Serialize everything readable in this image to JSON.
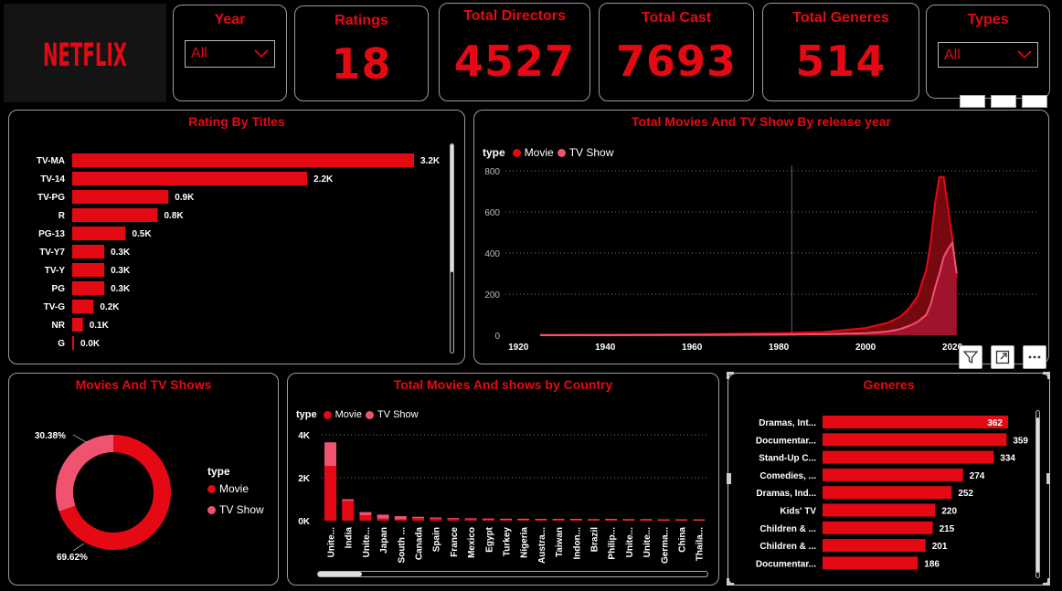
{
  "logo": "NETFLIX",
  "year_slicer": {
    "title": "Year",
    "value": "All"
  },
  "type_slicer": {
    "title": "Types",
    "value": "All"
  },
  "kpis": [
    {
      "title": "Ratings",
      "value": "18"
    },
    {
      "title": "Total Directors",
      "value": "4527"
    },
    {
      "title": "Total Cast",
      "value": "7693"
    },
    {
      "title": "Total Generes",
      "value": "514"
    }
  ],
  "colors": {
    "movie": "#e50914",
    "tv_show": "#ef5370",
    "accent": "#e50914",
    "background": "#000000"
  },
  "rating": {
    "title": "Rating By Titles",
    "chart_data": {
      "type": "bar",
      "orientation": "horizontal",
      "categories": [
        "TV-MA",
        "TV-14",
        "TV-PG",
        "R",
        "PG-13",
        "TV-Y7",
        "TV-Y",
        "PG",
        "TV-G",
        "NR",
        "G"
      ],
      "values": [
        3200,
        2200,
        900,
        800,
        500,
        300,
        300,
        300,
        200,
        100,
        0
      ],
      "labels": [
        "3.2K",
        "2.2K",
        "0.9K",
        "0.8K",
        "0.5K",
        "0.3K",
        "0.3K",
        "0.3K",
        "0.2K",
        "0.1K",
        "0.0K"
      ]
    }
  },
  "release": {
    "title": "Total Movies And TV Show By release year",
    "legend_title": "type",
    "chart_data": {
      "type": "area",
      "x_ticks": [
        "1920",
        "1940",
        "1960",
        "1980",
        "2000",
        "2020"
      ],
      "y_ticks": [
        "800",
        "600",
        "400",
        "200",
        "0"
      ],
      "xlim": [
        1917,
        2040
      ],
      "ylim": [
        0,
        800
      ],
      "grid": true,
      "series": [
        {
          "name": "Movie",
          "x": [
            1925,
            1940,
            1960,
            1980,
            1990,
            2000,
            2005,
            2008,
            2010,
            2012,
            2014,
            2015,
            2016,
            2017,
            2018,
            2019,
            2020,
            2021
          ],
          "values": [
            2,
            3,
            5,
            10,
            15,
            35,
            60,
            90,
            130,
            190,
            320,
            450,
            640,
            770,
            770,
            620,
            470,
            280
          ]
        },
        {
          "name": "TV Show",
          "x": [
            1925,
            1940,
            1960,
            1980,
            1990,
            2000,
            2005,
            2008,
            2010,
            2012,
            2014,
            2015,
            2016,
            2017,
            2018,
            2019,
            2020,
            2021
          ],
          "values": [
            0,
            0,
            1,
            3,
            5,
            10,
            18,
            30,
            45,
            65,
            100,
            150,
            230,
            300,
            380,
            420,
            450,
            300
          ]
        }
      ]
    }
  },
  "donut": {
    "title": "Movies And TV Shows",
    "legend_title": "type",
    "chart_data": {
      "type": "pie",
      "categories": [
        "Movie",
        "TV Show"
      ],
      "values": [
        69.62,
        30.38
      ],
      "labels": [
        "69.62%",
        "30.38%"
      ]
    }
  },
  "country": {
    "title": "Total Movies And shows by Country",
    "legend_title": "type",
    "chart_data": {
      "type": "bar",
      "stacked": true,
      "y_ticks": [
        "4K",
        "2K",
        "0K"
      ],
      "ylim": [
        0,
        4000
      ],
      "categories": [
        "Unite...",
        "India",
        "Unite...",
        "Japan",
        "South ...",
        "Canada",
        "Spain",
        "France",
        "Mexico",
        "Egypt",
        "Turkey",
        "Nigeria",
        "Austra...",
        "Taiwan",
        "Indon...",
        "Brazil",
        "Philip...",
        "Unite...",
        "Unite...",
        "Germa...",
        "China",
        "Thaila..."
      ],
      "series": [
        {
          "name": "Movie",
          "values": [
            2550,
            920,
            250,
            100,
            60,
            120,
            100,
            80,
            70,
            90,
            70,
            80,
            40,
            40,
            70,
            50,
            70,
            60,
            50,
            40,
            40,
            40
          ]
        },
        {
          "name": "TV Show",
          "values": [
            1100,
            80,
            150,
            180,
            150,
            60,
            50,
            40,
            40,
            10,
            20,
            10,
            40,
            40,
            10,
            20,
            10,
            10,
            20,
            20,
            20,
            20
          ]
        }
      ]
    }
  },
  "genres": {
    "title": "Generes",
    "chart_data": {
      "type": "bar",
      "orientation": "horizontal",
      "categories": [
        "Dramas, Int...",
        "Documentar...",
        "Stand-Up C...",
        "Comedies, ...",
        "Dramas, Ind...",
        "Kids' TV",
        "Children & ...",
        "Children & ...",
        "Documentar..."
      ],
      "values": [
        362,
        359,
        334,
        274,
        252,
        220,
        215,
        201,
        186
      ],
      "xlim": [
        0,
        362
      ]
    }
  }
}
